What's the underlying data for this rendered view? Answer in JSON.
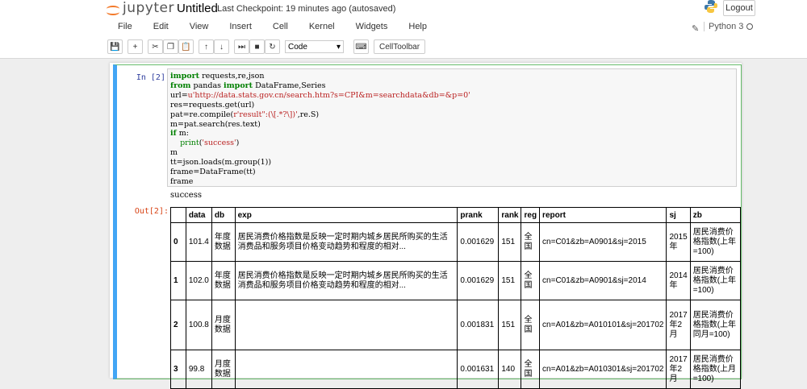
{
  "app": {
    "logo_text": "jupyter",
    "notebook_name": "Untitled",
    "checkpoint": "Last Checkpoint: 19 minutes ago (autosaved)",
    "logout_label": "Logout",
    "kernel_name": "Python 3"
  },
  "menu": [
    "File",
    "Edit",
    "View",
    "Insert",
    "Cell",
    "Kernel",
    "Widgets",
    "Help"
  ],
  "toolbar": {
    "cell_type": "Code",
    "celltoolbar_label": "CellToolbar"
  },
  "cell": {
    "in_prompt": "In  [2]:",
    "out_prompt": "Out[2]:",
    "stdout": "success",
    "code_lines": [
      "import requests,re,json",
      "from pandas import DataFrame,Series",
      "url=u'http://data.stats.gov.cn/search.htm?s=CPI&m=searchdata&db=&p=0'",
      "res=requests.get(url)",
      "pat=re.compile(r'result\":(\\[.*?\\])',re.S)",
      "m=pat.search(res.text)",
      "if m:",
      "    print('success')",
      "m",
      "tt=json.loads(m.group(1))",
      "frame=DataFrame(tt)",
      "frame"
    ]
  },
  "dataframe": {
    "columns": [
      "",
      "data",
      "db",
      "exp",
      "prank",
      "rank",
      "reg",
      "report",
      "sj",
      "zb"
    ],
    "rows": [
      [
        "0",
        "101.4",
        "年度数据",
        "居民消费价格指数是反映一定时期内城乡居民所购买的生活消费品和服务项目价格变动趋势和程度的相对...",
        "0.001629",
        "151",
        "全国",
        "cn=C01&zb=A0901&sj=2015",
        "2015年",
        "居民消费价格指数(上年=100)"
      ],
      [
        "1",
        "102.0",
        "年度数据",
        "居民消费价格指数是反映一定时期内城乡居民所购买的生活消费品和服务项目价格变动趋势和程度的相对...",
        "0.001629",
        "151",
        "全国",
        "cn=C01&zb=A0901&sj=2014",
        "2014年",
        "居民消费价格指数(上年=100)"
      ],
      [
        "2",
        "100.8",
        "月度数据",
        "",
        "0.001831",
        "151",
        "全国",
        "cn=A01&zb=A010101&sj=201702",
        "2017年2月",
        "居民消费价格指数(上年同月=100)"
      ],
      [
        "3",
        "99.8",
        "月度数据",
        "",
        "0.001631",
        "140",
        "全国",
        "cn=A01&zb=A010301&sj=201702",
        "2017年2月",
        "居民消费价格指数(上月=100)"
      ]
    ]
  },
  "colors": {
    "selected_border": "#66bb6a",
    "in_prompt": "#303f9f",
    "out_prompt": "#d84315"
  }
}
